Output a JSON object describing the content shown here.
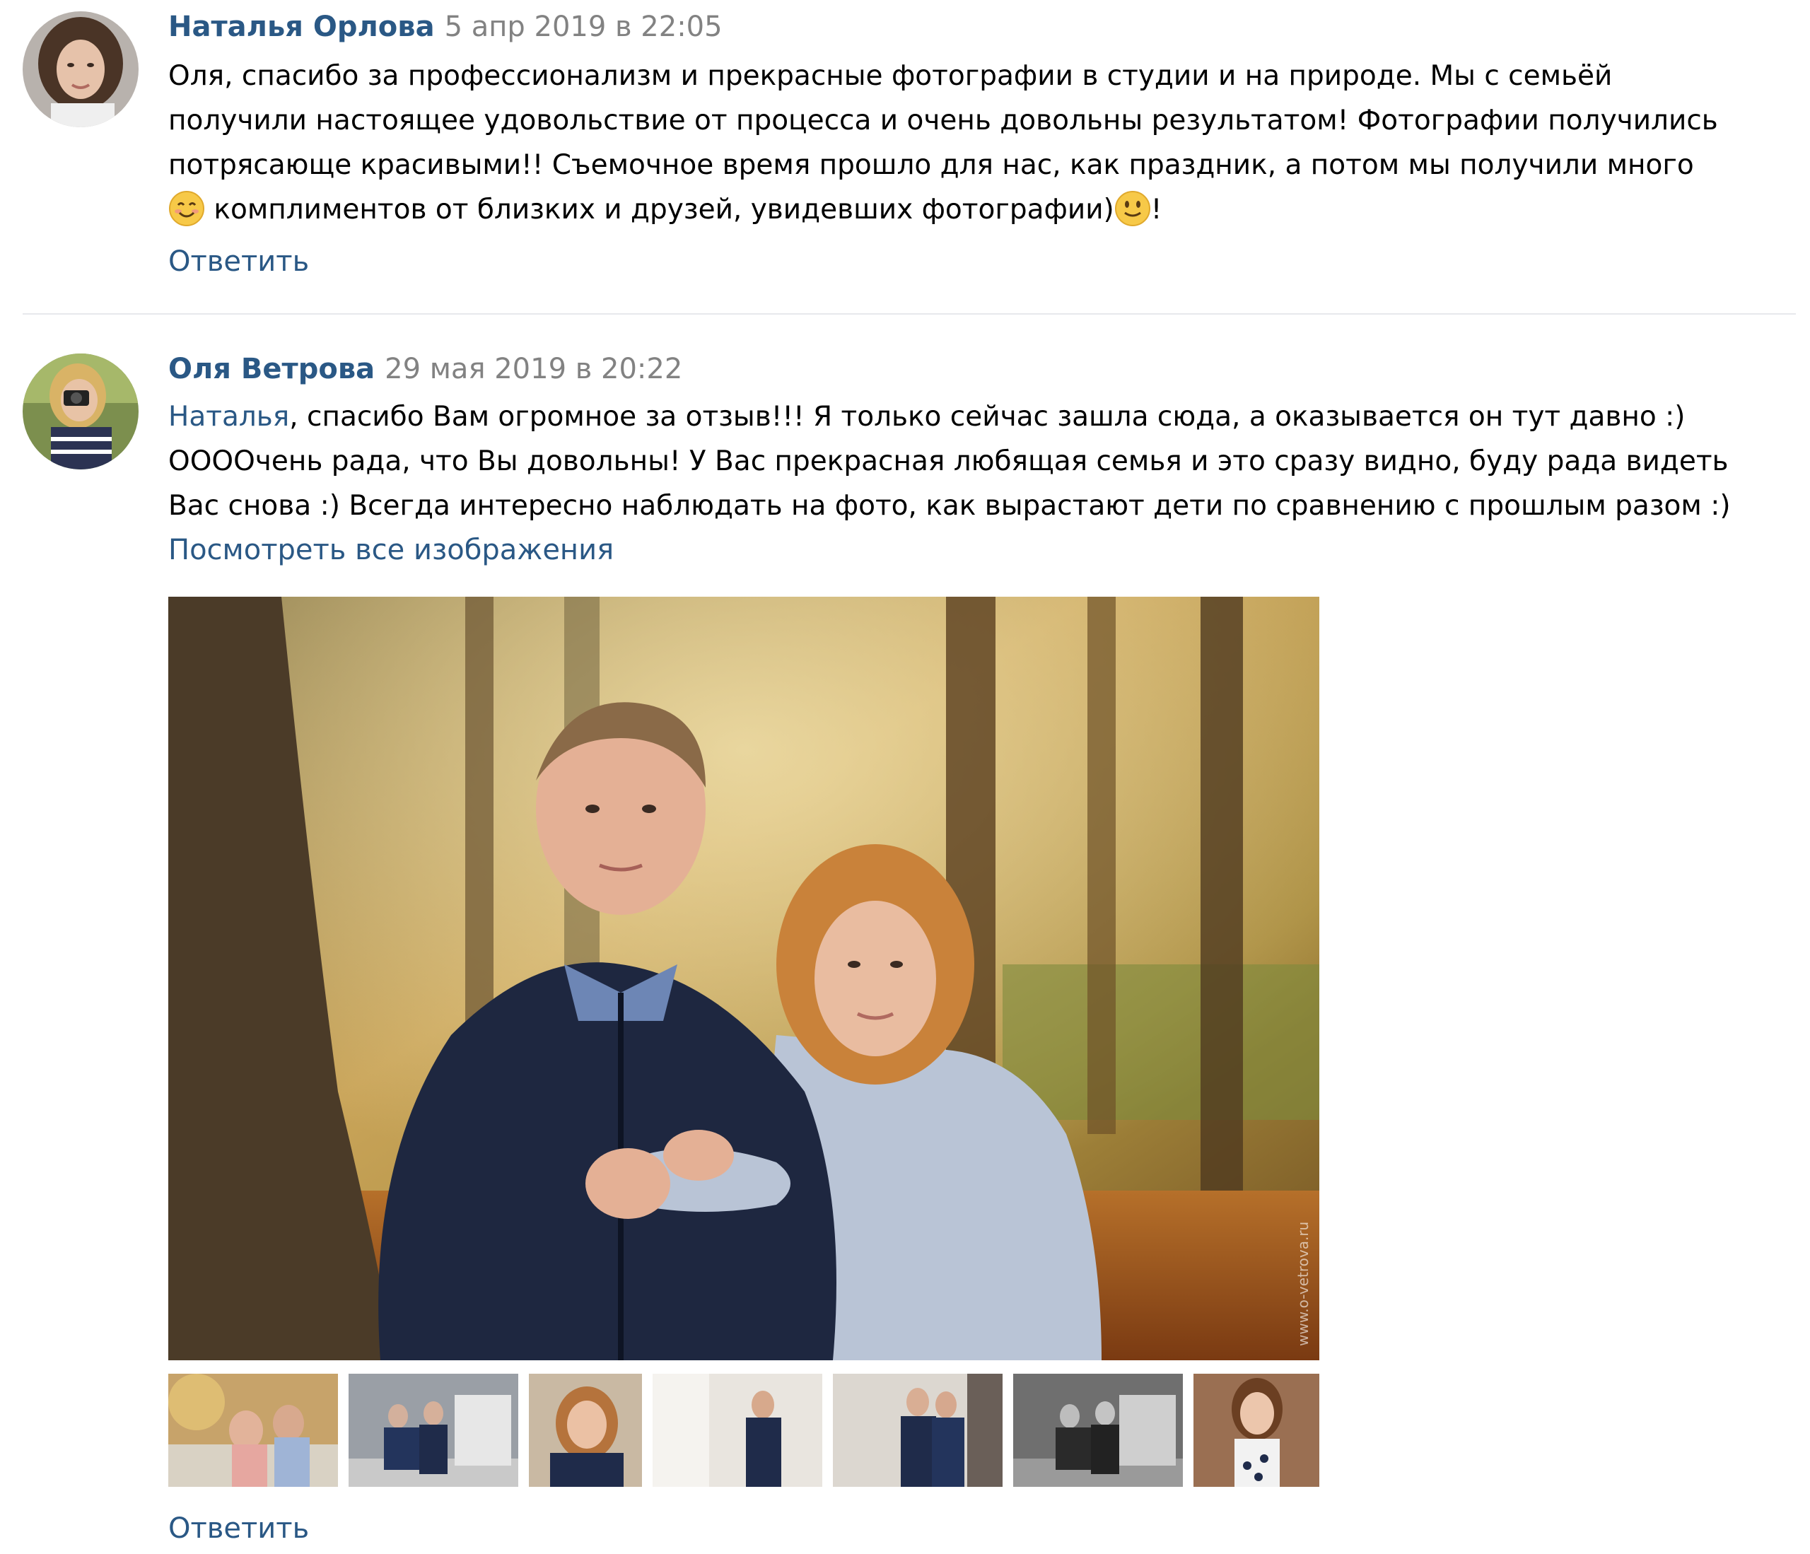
{
  "comments": [
    {
      "author": "Наталья Орлова",
      "date": "5 апр 2019 в 22:05",
      "lines": [
        "Оля, спасибо за профессионализм и прекрасные фотографии в студии и на природе. Мы с семьёй",
        "получили настоящее удовольствие от процесса и очень довольны результатом! Фотографии получились",
        "потрясающе красивыми!! Съемочное время прошло для нас, как праздник, а потом мы получили много"
      ],
      "last_line": " комплиментов от близких и друзей, увидевших фотографии)",
      "last_line_end": "!",
      "reply_label": "Ответить"
    },
    {
      "author": "Оля Ветрова",
      "date": "29 мая 2019 в 20:22",
      "mention": "Наталья",
      "line1_rest": ", спасибо Вам огромное за отзыв!!! Я только сейчас зашла сюда, а оказывается он тут давно :)",
      "lines": [
        "ООООчень рада, что Вы довольны! У Вас прекрасная любящая семья и это сразу видно, буду рада видеть",
        "Вас снова :) Всегда интересно наблюдать на фото, как вырастают дети по сравнению с прошлым разом :)"
      ],
      "view_all_label": "Посмотреть все изображения",
      "photo_watermark": "www.o-vetrova.ru",
      "thumbnail_count": 7,
      "reply_label": "Ответить"
    }
  ],
  "colors": {
    "link": "#2a5885",
    "muted": "#828282",
    "divider": "#e7e8ec",
    "text": "#000000"
  },
  "icons": [
    "smiling-face-emoji-icon",
    "slight-smile-emoji-icon"
  ]
}
